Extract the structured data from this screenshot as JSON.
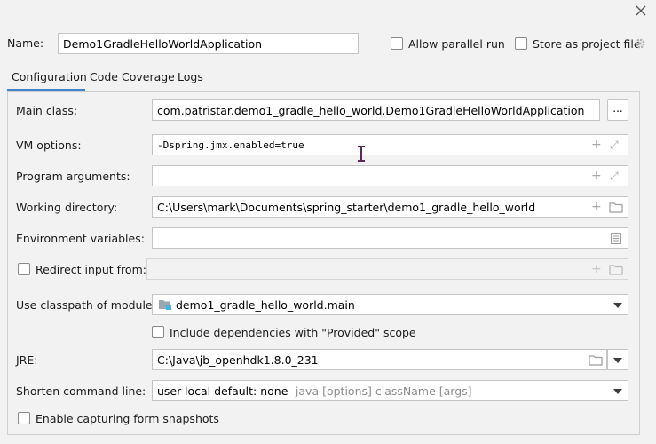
{
  "dialog": {
    "close_icon": "close-icon",
    "settings_icon": "gear-icon"
  },
  "name_row": {
    "label": "Name:",
    "value": "Demo1GradleHelloWorldApplication",
    "allow_parallel_label": "Allow parallel run",
    "store_label": "Store as project file"
  },
  "tabs": [
    {
      "label": "Configuration",
      "active": true
    },
    {
      "label": "Code Coverage",
      "active": false
    },
    {
      "label": "Logs",
      "active": false
    }
  ],
  "form": {
    "main_class": {
      "label": "Main class:",
      "value": "com.patristar.demo1_gradle_hello_world.Demo1GradleHelloWorldApplication",
      "browse_label": "..."
    },
    "vm_options": {
      "label": "VM options:",
      "value": "-Dspring.jmx.enabled=true"
    },
    "program_args": {
      "label": "Program arguments:",
      "value": ""
    },
    "working_dir": {
      "label": "Working directory:",
      "value": "C:\\Users\\mark\\Documents\\spring_starter\\demo1_gradle_hello_world"
    },
    "env_vars": {
      "label": "Environment variables:",
      "value": ""
    },
    "redirect_input": {
      "label": "Redirect input from:",
      "value": ""
    },
    "classpath": {
      "label": "Use classpath of module:",
      "value": "demo1_gradle_hello_world.main"
    },
    "include_deps": {
      "label": "Include dependencies with \"Provided\" scope"
    },
    "jre": {
      "label": "JRE:",
      "value": "C:\\Java\\jb_openhdk1.8.0_231"
    },
    "shorten_cmd": {
      "label": "Shorten command line:",
      "value": "user-local default: none",
      "hint": " - java [options] className [args]"
    },
    "capture_snapshots": {
      "label": "Enable capturing form snapshots"
    }
  },
  "colors": {
    "tab_underline": "#4083c9",
    "folder_module": "#9aa7b0",
    "text_cursor": "#5a2a5a"
  }
}
